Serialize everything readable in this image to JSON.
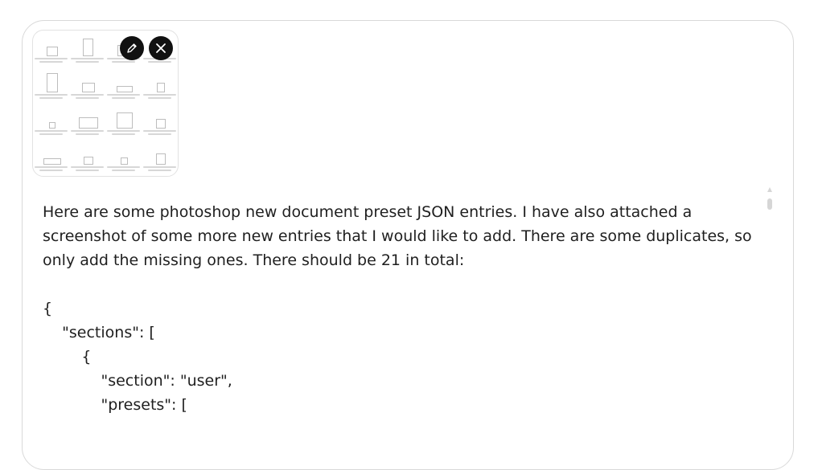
{
  "attachment": {
    "thumb_cells": [
      {
        "w": 12,
        "h": 10
      },
      {
        "w": 11,
        "h": 20
      },
      {
        "w": 16,
        "h": 12
      },
      {
        "w": 12,
        "h": 14
      },
      {
        "w": 12,
        "h": 22
      },
      {
        "w": 14,
        "h": 10
      },
      {
        "w": 18,
        "h": 6
      },
      {
        "w": 8,
        "h": 10
      },
      {
        "w": 6,
        "h": 6
      },
      {
        "w": 22,
        "h": 12
      },
      {
        "w": 18,
        "h": 18
      },
      {
        "w": 10,
        "h": 10
      },
      {
        "w": 20,
        "h": 6
      },
      {
        "w": 10,
        "h": 8
      },
      {
        "w": 7,
        "h": 7
      },
      {
        "w": 10,
        "h": 12
      }
    ]
  },
  "message": {
    "paragraph": "Here are some photoshop new document preset JSON entries. I have also attached a screenshot of some more new entries that I would like to add. There are some duplicates, so only add the missing ones. There should be 21 in total:",
    "code_lines": [
      "{",
      "    \"sections\": [",
      "        {",
      "            \"section\": \"user\",",
      "            \"presets\": ["
    ]
  },
  "icons": {
    "edit": "pencil-icon",
    "remove": "close-icon"
  },
  "colors": {
    "button_bg": "#111111",
    "border": "#d9d9d9",
    "text": "#1f1f1f"
  }
}
